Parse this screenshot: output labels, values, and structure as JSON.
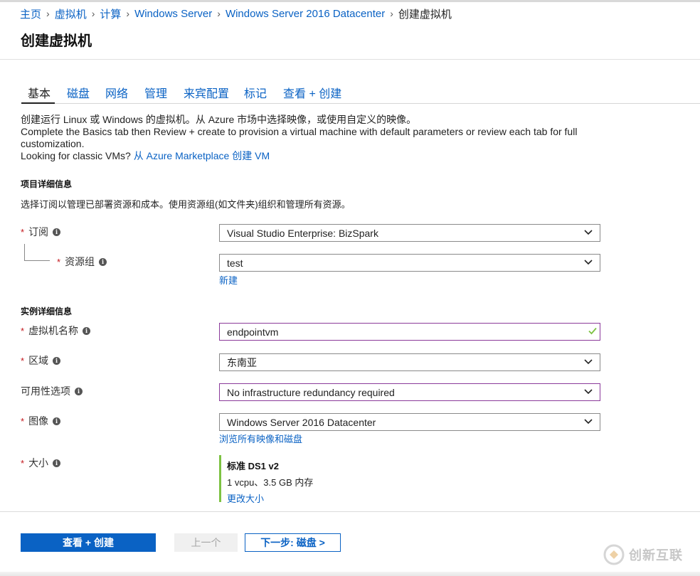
{
  "breadcrumb": {
    "items": [
      "主页",
      "虚拟机",
      "计算",
      "Windows Server",
      "Windows Server 2016 Datacenter"
    ],
    "current": "创建虚拟机"
  },
  "page": {
    "title": "创建虚拟机"
  },
  "tabs": [
    "基本",
    "磁盘",
    "网络",
    "管理",
    "来宾配置",
    "标记",
    "查看 + 创建"
  ],
  "intro": {
    "line1": "创建运行 Linux 或 Windows 的虚拟机。从 Azure 市场中选择映像，或使用自定义的映像。",
    "line2": "Complete the Basics tab then Review + create to provision a virtual machine with default parameters or review each tab for full",
    "line3": "customization.",
    "line4_text": "Looking for classic VMs?",
    "line4_link": "从 Azure Marketplace 创建 VM"
  },
  "project": {
    "title": "项目详细信息",
    "description": "选择订阅以管理已部署资源和成本。使用资源组(如文件夹)组织和管理所有资源。",
    "subscription_label": "订阅",
    "subscription_value": "Visual Studio Enterprise: BizSpark",
    "resource_group_label": "资源组",
    "resource_group_value": "test",
    "create_new_link": "新建"
  },
  "instance": {
    "title": "实例详细信息",
    "vm_name_label": "虚拟机名称",
    "vm_name_value": "endpointvm",
    "region_label": "区域",
    "region_value": "东南亚",
    "availability_label": "可用性选项",
    "availability_value": "No infrastructure redundancy required",
    "image_label": "图像",
    "image_value": "Windows Server 2016 Datacenter",
    "browse_images_link": "浏览所有映像和磁盘",
    "size_label": "大小",
    "size_name": "标准 DS1 v2",
    "size_spec": "1 vcpu、3.5 GB 内存",
    "change_size_link": "更改大小"
  },
  "required_mark": "*",
  "info_glyph": "i",
  "footer": {
    "review_create": "查看 + 创建",
    "previous": "上一个",
    "next": "下一步: 磁盘 >"
  },
  "watermark": {
    "text": "创新互联"
  },
  "colors": {
    "link": "#0a62c4",
    "primary_button": "#0a62c4",
    "required": "#c4161c",
    "valid_check": "#7dc243",
    "focus_border": "#8b3a9a"
  }
}
